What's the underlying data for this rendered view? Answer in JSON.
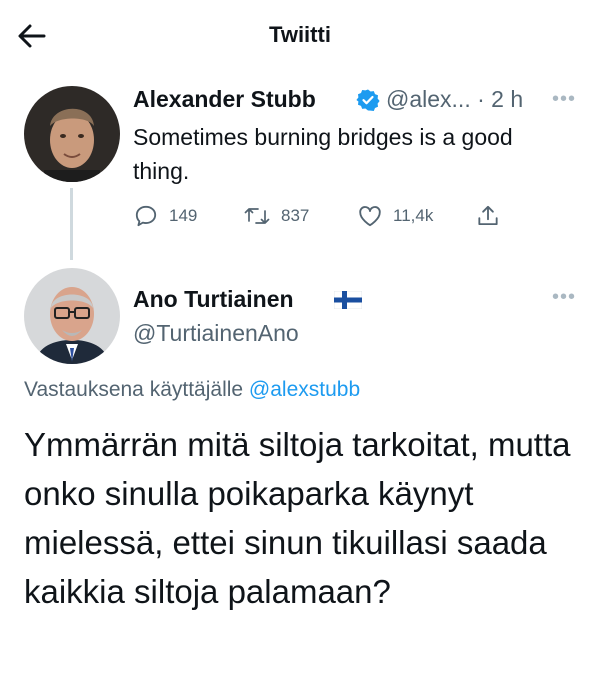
{
  "header": {
    "title": "Twiitti"
  },
  "tweet": {
    "author_name": "Alexander Stubb",
    "handle_time": "@alex... · 2 h",
    "text": "Sometimes burning bridges is a good thing.",
    "stats": {
      "replies": "149",
      "retweets": "837",
      "likes": "11,4k"
    }
  },
  "reply": {
    "author_name": "Ano Turtiainen",
    "handle": "@TurtiainenAno",
    "replying_to_prefix": "Vastauksena käyttäjälle",
    "replying_to_handle": "@alexstubb",
    "text": "Ymmärrän mitä siltoja tarkoitat, mutta onko sinulla poikaparka käynyt mielessä, ettei sinun tikuillasi saada kaikkia siltoja palamaan?"
  },
  "icons": [
    "back-arrow-icon",
    "verified-badge-icon",
    "more-icon",
    "reply-icon",
    "retweet-icon",
    "like-icon",
    "share-icon",
    "finland-flag-icon"
  ],
  "colors": {
    "text": "#0f1419",
    "muted": "#536471",
    "accent": "#1d9bf0"
  }
}
